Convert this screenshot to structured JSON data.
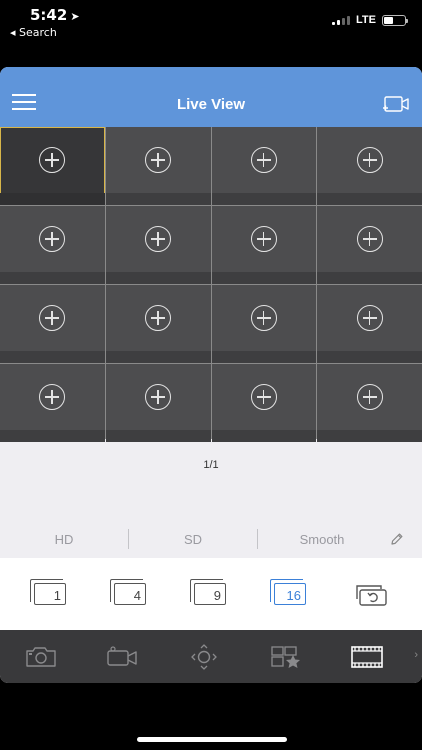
{
  "status_bar": {
    "time": "5:42",
    "location_arrow": "➤",
    "back_label": "◂ Search",
    "network": "LTE",
    "battery_level": 0.45
  },
  "header": {
    "title": "Live View",
    "menu_icon": "hamburger-icon",
    "record_icon": "record-all-icon"
  },
  "grid": {
    "columns": 4,
    "rows": 4,
    "selected_index": 0
  },
  "pager": {
    "label": "1/1"
  },
  "quality": {
    "options": [
      "HD",
      "SD",
      "Smooth"
    ]
  },
  "layouts": {
    "options": [
      "1",
      "4",
      "9",
      "16"
    ],
    "active": "16"
  },
  "toolbar": {
    "items": [
      "snapshot-icon",
      "record-icon",
      "ptz-icon",
      "favorites-icon",
      "playback-film-icon"
    ],
    "more": "›"
  },
  "colors": {
    "header": "#5f95da",
    "accent": "#3b80d8",
    "selected_border": "#d8b64a",
    "toolbar": "#39393b"
  }
}
